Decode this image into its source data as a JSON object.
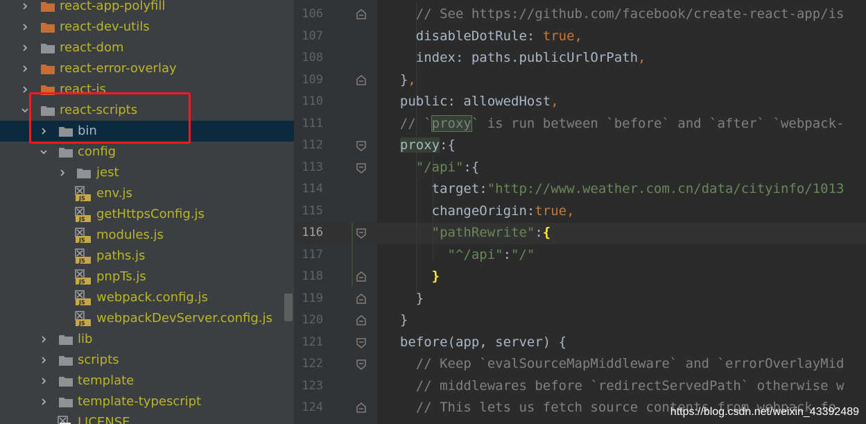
{
  "tree": {
    "items": [
      {
        "label": "react-app-polyfill",
        "kind": "folder",
        "color": "orange",
        "depth": 1,
        "arrow": "right"
      },
      {
        "label": "react-dev-utils",
        "kind": "folder",
        "color": "orange",
        "depth": 1,
        "arrow": "right"
      },
      {
        "label": "react-dom",
        "kind": "folder",
        "color": "gray",
        "depth": 1,
        "arrow": "right"
      },
      {
        "label": "react-error-overlay",
        "kind": "folder",
        "color": "orange",
        "depth": 1,
        "arrow": "right"
      },
      {
        "label": "react-is",
        "kind": "folder",
        "color": "orange",
        "depth": 1,
        "arrow": "right"
      },
      {
        "label": "react-scripts",
        "kind": "folder",
        "color": "gray",
        "depth": 1,
        "arrow": "down"
      },
      {
        "label": "bin",
        "kind": "folder",
        "color": "gray",
        "depth": 2,
        "arrow": "right",
        "selected": true
      },
      {
        "label": "config",
        "kind": "folder",
        "color": "gray",
        "depth": 2,
        "arrow": "down"
      },
      {
        "label": "jest",
        "kind": "folder",
        "color": "gray",
        "depth": 3,
        "arrow": "right"
      },
      {
        "label": "env.js",
        "kind": "js",
        "depth": 3
      },
      {
        "label": "getHttpsConfig.js",
        "kind": "js",
        "depth": 3
      },
      {
        "label": "modules.js",
        "kind": "js",
        "depth": 3
      },
      {
        "label": "paths.js",
        "kind": "js",
        "depth": 3
      },
      {
        "label": "pnpTs.js",
        "kind": "js",
        "depth": 3
      },
      {
        "label": "webpack.config.js",
        "kind": "js",
        "depth": 3
      },
      {
        "label": "webpackDevServer.config.js",
        "kind": "js",
        "depth": 3
      },
      {
        "label": "lib",
        "kind": "folder",
        "color": "gray",
        "depth": 2,
        "arrow": "right"
      },
      {
        "label": "scripts",
        "kind": "folder",
        "color": "gray",
        "depth": 2,
        "arrow": "right"
      },
      {
        "label": "template",
        "kind": "folder",
        "color": "gray",
        "depth": 2,
        "arrow": "right"
      },
      {
        "label": "template-typescript",
        "kind": "folder",
        "color": "gray",
        "depth": 2,
        "arrow": "right"
      },
      {
        "label": "LICENSE",
        "kind": "text",
        "depth": 2
      }
    ]
  },
  "editor": {
    "current_line": 116,
    "lines": [
      {
        "n": "106",
        "fold": "end",
        "tokens": [
          [
            "cm",
            "    // See https://github.com/facebook/create-react-app/is"
          ]
        ]
      },
      {
        "n": "107",
        "tokens": [
          [
            "",
            "    disableDotRule: "
          ],
          [
            "kw",
            "true"
          ],
          [
            "kw",
            ","
          ]
        ]
      },
      {
        "n": "108",
        "tokens": [
          [
            "",
            "    index: paths.publicUrlOrPath"
          ],
          [
            "kw",
            ","
          ]
        ]
      },
      {
        "n": "109",
        "fold": "end",
        "tokens": [
          [
            "",
            "  }"
          ],
          [
            "kw",
            ","
          ]
        ]
      },
      {
        "n": "110",
        "tokens": [
          [
            "",
            "  public: allowedHost"
          ],
          [
            "kw",
            ","
          ]
        ]
      },
      {
        "n": "111",
        "tokens": [
          [
            "cm",
            "  // `"
          ],
          [
            "cm-box",
            "proxy"
          ],
          [
            "cm",
            "` is run between `before` and `after` `webpack-"
          ]
        ]
      },
      {
        "n": "112",
        "fold": "start",
        "tokens": [
          [
            "hl",
            "  proxy"
          ],
          [
            "",
            ":{"
          ]
        ]
      },
      {
        "n": "113",
        "fold": "start",
        "tokens": [
          [
            "str",
            "    \"/api\""
          ],
          [
            "",
            ":{"
          ]
        ]
      },
      {
        "n": "114",
        "tokens": [
          [
            "",
            "      target:"
          ],
          [
            "str",
            "\"http://www.weather.com.cn/data/cityinfo/1013"
          ]
        ]
      },
      {
        "n": "115",
        "tokens": [
          [
            "",
            "      changeOrigin:"
          ],
          [
            "kw",
            "true,"
          ]
        ]
      },
      {
        "n": "116",
        "fold": "start",
        "tokens": [
          [
            "str",
            "      \"pathRewrite\""
          ],
          [
            "",
            ":"
          ],
          [
            "brace",
            "{"
          ]
        ]
      },
      {
        "n": "117",
        "tokens": [
          [
            "str",
            "        \"^/api\""
          ],
          [
            "",
            ":"
          ],
          [
            "str",
            "\"/\""
          ]
        ]
      },
      {
        "n": "118",
        "fold": "end",
        "tokens": [
          [
            "brace",
            "      }"
          ]
        ]
      },
      {
        "n": "119",
        "fold": "end",
        "tokens": [
          [
            "",
            "    }"
          ]
        ]
      },
      {
        "n": "120",
        "fold": "end",
        "tokens": [
          [
            "",
            "  }"
          ]
        ]
      },
      {
        "n": "121",
        "fold": "start",
        "tokens": [
          [
            "",
            "  before(app, server) {"
          ]
        ]
      },
      {
        "n": "122",
        "fold": "start",
        "tokens": [
          [
            "cm",
            "    // Keep `evalSourceMapMiddleware` and `errorOverlayMid"
          ]
        ]
      },
      {
        "n": "123",
        "tokens": [
          [
            "cm",
            "    // middlewares before `redirectServedPath` otherwise w"
          ]
        ]
      },
      {
        "n": "124",
        "fold": "end",
        "tokens": [
          [
            "cm",
            "    // This lets us fetch source contents from webpack fo"
          ]
        ]
      }
    ]
  },
  "watermark": "https://blog.csdn.net/weixin_43392489",
  "colors": {
    "tree_bg": "#3c3f41",
    "editor_bg": "#2b2b2b",
    "selection": "#0d293e",
    "tree_label": "#bbb529",
    "highlight_border": "#ff1a1a",
    "keyword": "#cc7832",
    "string": "#6a8759",
    "comment": "#808080"
  }
}
